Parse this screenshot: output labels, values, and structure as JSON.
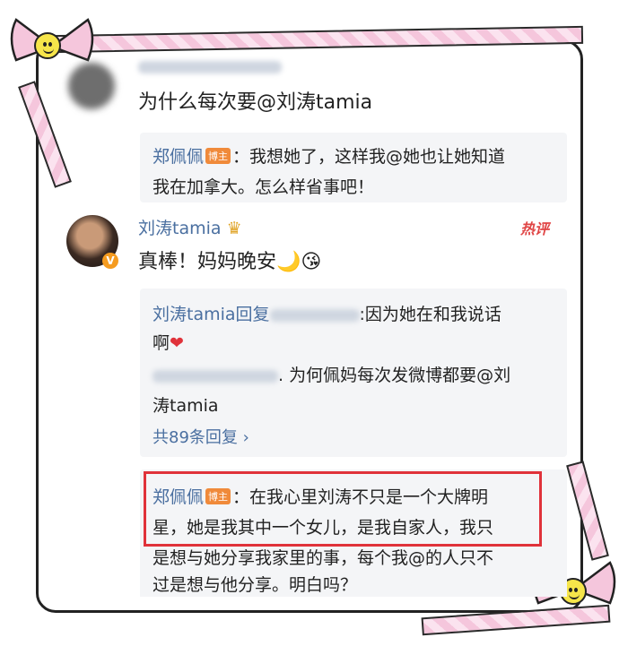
{
  "post_header": {
    "question": "为什么每次要@刘涛tamia"
  },
  "reply1": {
    "name": "郑佩佩",
    "badge": "博主",
    "text_line1": "：我想她了，这样我@她也让她知道",
    "text_line2": "我在加拿大。怎么样省事吧！"
  },
  "comment": {
    "name": "刘涛tamia",
    "crown_icon": "crown-icon",
    "hot_tag": "热评",
    "text": "真棒！妈妈晚安",
    "moon_emoji": "🌙",
    "kiss_emoji": "😘"
  },
  "sub_replies": {
    "line1_name": "刘涛tamia回复",
    "line1_text": ":因为她在和我说话",
    "line2_text": "啊",
    "heart": "❤",
    "line3_text": ". 为何佩妈每次发微博都要@刘",
    "line4_text": "涛tamia",
    "more": "共89条回复 ›"
  },
  "highlight_reply": {
    "name": "郑佩佩",
    "badge": "博主",
    "line1": "：在我心里刘涛不只是一个大牌明",
    "line2": "星，她是我其中一个女儿，是我自家人，我只",
    "line3": "是想与她分享我家里的事，每个我@的人只不",
    "line4": "过是想与他分享。明白吗？"
  },
  "decor": {
    "ribbon_pink": "#f5c6dc",
    "highlight_red": "#e0323a",
    "smiley_icon": "smiley-icon"
  }
}
